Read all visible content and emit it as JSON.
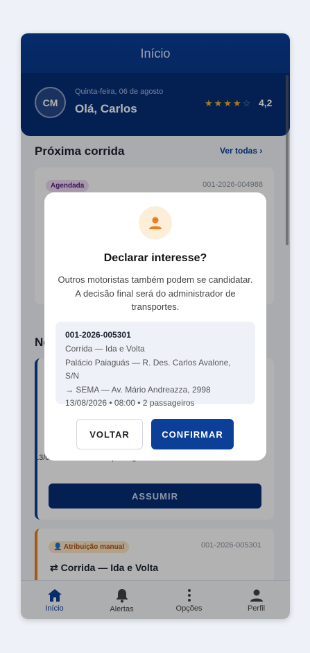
{
  "header": {
    "title": "Início",
    "initials": "CM",
    "date": "Quinta-feira, 06 de agosto",
    "greeting": "Olá, Carlos",
    "rating": "4,2",
    "rating_value": 4.2
  },
  "next_ride": {
    "section_title": "Próxima corrida",
    "see_all": "Ver todas",
    "status": "Agendada",
    "code": "001-2026-004988"
  },
  "second_section": {
    "title_visible": "No",
    "meta": "13/08/2026 · 08:00 · 2 passageiros",
    "assume_label": "ASSUMIR"
  },
  "third_card": {
    "badge": "Atribuição manual",
    "code": "001-2026-005301",
    "trip": "Corrida — Ida e Volta"
  },
  "tabs": [
    {
      "label": "Início",
      "icon": "home-icon",
      "active": true
    },
    {
      "label": "Alertas",
      "icon": "bell-icon",
      "active": false
    },
    {
      "label": "Opções",
      "icon": "more-vertical-icon",
      "active": false
    },
    {
      "label": "Perfil",
      "icon": "person-icon",
      "active": false
    }
  ],
  "modal": {
    "icon": "person-icon",
    "title": "Declarar interesse?",
    "message": "Outros motoristas também podem se candidatar. A decisão final será do administrador de transportes.",
    "ride_code": "001-2026-005301",
    "ride_type": "Corrida — Ida e Volta",
    "origin": "Palácio Paiaguás — R. Des. Carlos Avalone, S/N",
    "destination": "→ SEMA — Av. Mário Andreazza, 2998",
    "schedule": "13/08/2026 • 08:00 • 2 passageiros",
    "back_label": "VOLTAR",
    "confirm_label": "CONFIRMAR"
  },
  "colors": {
    "primary": "#0b3f98",
    "accent_orange": "#ec7d1c",
    "star": "#f2b21b"
  }
}
